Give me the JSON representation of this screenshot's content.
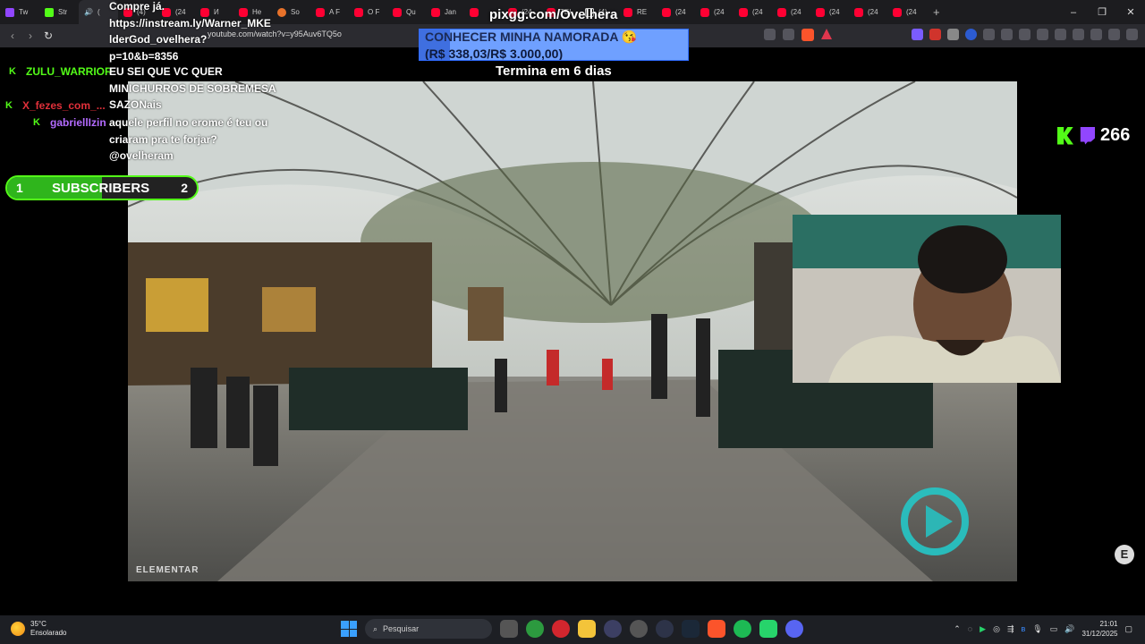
{
  "browser": {
    "tabs": [
      {
        "label": "Tw",
        "icon": "twitch-icon"
      },
      {
        "label": "Str",
        "icon": "kick-icon"
      },
      {
        "label": "(",
        "icon": "speaker-icon",
        "active": true
      },
      {
        "label": "(4)",
        "icon": "youtube-icon"
      },
      {
        "label": "(24",
        "icon": "youtube-icon"
      },
      {
        "label": "И",
        "icon": "youtube-icon"
      },
      {
        "label": "He",
        "icon": "youtube-icon"
      },
      {
        "label": "So",
        "icon": "coin-icon"
      },
      {
        "label": "A F",
        "icon": "youtube-icon"
      },
      {
        "label": "O F",
        "icon": "youtube-icon"
      },
      {
        "label": "Qu",
        "icon": "youtube-icon"
      },
      {
        "label": "Jan",
        "icon": "youtube-icon"
      },
      {
        "label": "",
        "icon": "youtube-icon"
      },
      {
        "label": "(24",
        "icon": "youtube-icon"
      },
      {
        "label": "TEI",
        "icon": "youtube-icon"
      },
      {
        "label": "(4)",
        "icon": "tiktok-icon"
      },
      {
        "label": "RE",
        "icon": "youtube-icon"
      },
      {
        "label": "(24",
        "icon": "youtube-icon"
      },
      {
        "label": "(24",
        "icon": "youtube-icon"
      },
      {
        "label": "(24",
        "icon": "youtube-icon"
      },
      {
        "label": "(24",
        "icon": "youtube-icon"
      },
      {
        "label": "(24",
        "icon": "youtube-icon"
      },
      {
        "label": "(24",
        "icon": "youtube-icon"
      },
      {
        "label": "(24",
        "icon": "youtube-icon"
      }
    ],
    "new_tab": "+",
    "url": "youtube.com/watch?v=y95Auv6TQ5o",
    "window": {
      "minimize": "–",
      "maximize": "❐",
      "close": "✕"
    }
  },
  "stream": {
    "pix_url": "pixgg.com/Ovelhera",
    "goal": {
      "title": "CONHECER MINHA NAMORADA 😘",
      "amount": "(R$ 338,03/R$ 3.000,00)",
      "progress": 0.113
    },
    "ends_in": "Termina em 6 dias",
    "chat": {
      "message_1": [
        "Compre já.",
        "https://instream.ly/Warner_MKE",
        "lderGod_ovelhera?",
        "p=10&b=8356"
      ],
      "user_2": "ZULU_WARRIOR",
      "message_2": "EU SEI QUE VC QUER",
      "message_2b": [
        "MINICHURROS DE SOBREMESA",
        "SAZONais"
      ],
      "user_3": "X_fezes_com_...",
      "user_4": "gabriellIzin",
      "message_4": [
        "aquele perfil no erome é teu ou",
        "criaram pra te forjar?",
        "@ovelheram"
      ]
    },
    "subscribers": {
      "current": "1",
      "label": "SUBSCRIBERS",
      "goal": "2",
      "progress": 0.5
    },
    "viewers": "266",
    "video_watermark": "ELEMENTAR",
    "side_logo": "E"
  },
  "taskbar": {
    "weather": {
      "temp": "35°C",
      "condition": "Ensolarado"
    },
    "search_placeholder": "Pesquisar",
    "time": "21:01",
    "date": "31/12/2025"
  },
  "colors": {
    "kick_green": "#53fc18",
    "twitch_purple": "#9146ff",
    "goal_blue": "#3f6fe0"
  }
}
